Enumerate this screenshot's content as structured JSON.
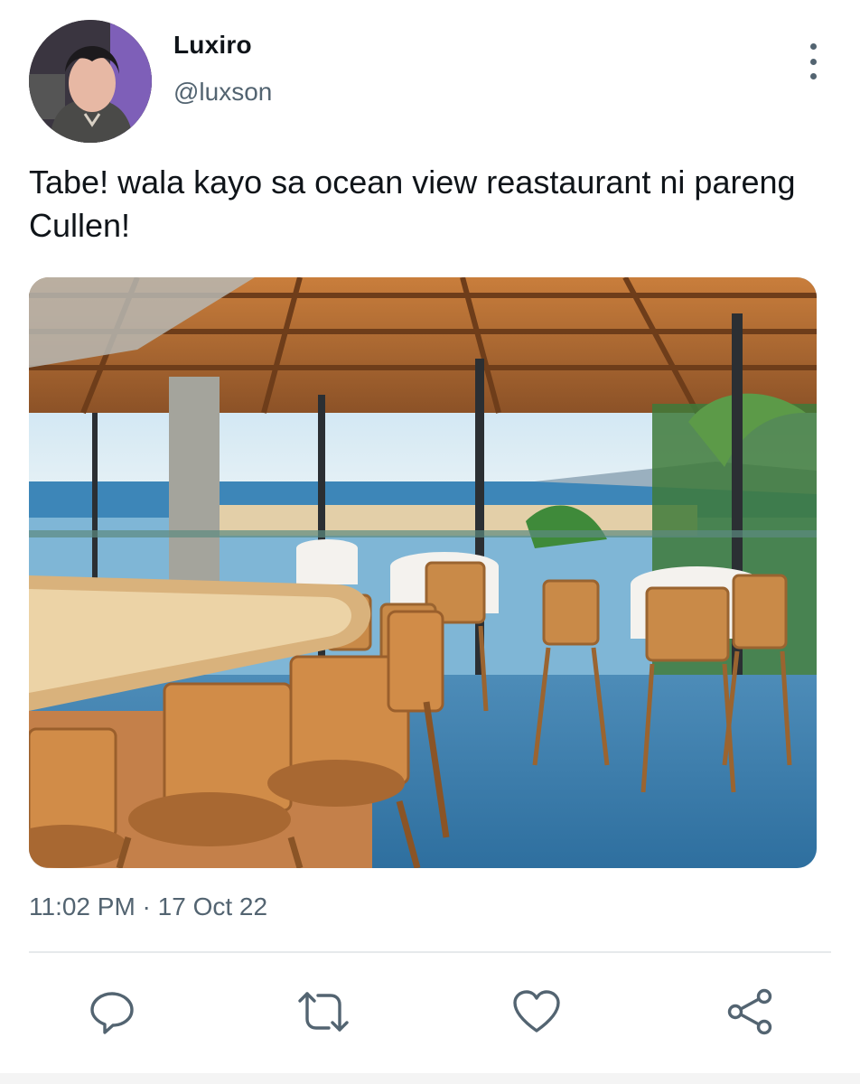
{
  "tweet": {
    "display_name": "Luxiro",
    "handle": "@luxson",
    "text": "Tabe! wala kayo sa ocean view reastaurant ni pareng Cullen!",
    "timestamp": "11:02 PM · 17 Oct 22"
  },
  "media": {
    "description_icon": "restaurant-photo"
  },
  "actions": {
    "reply_icon": "reply-icon",
    "retweet_icon": "retweet-icon",
    "like_icon": "heart-icon",
    "share_icon": "share-icon"
  },
  "colors": {
    "text_primary": "#0f1419",
    "text_secondary": "#536471",
    "divider": "#e6e9eb"
  }
}
